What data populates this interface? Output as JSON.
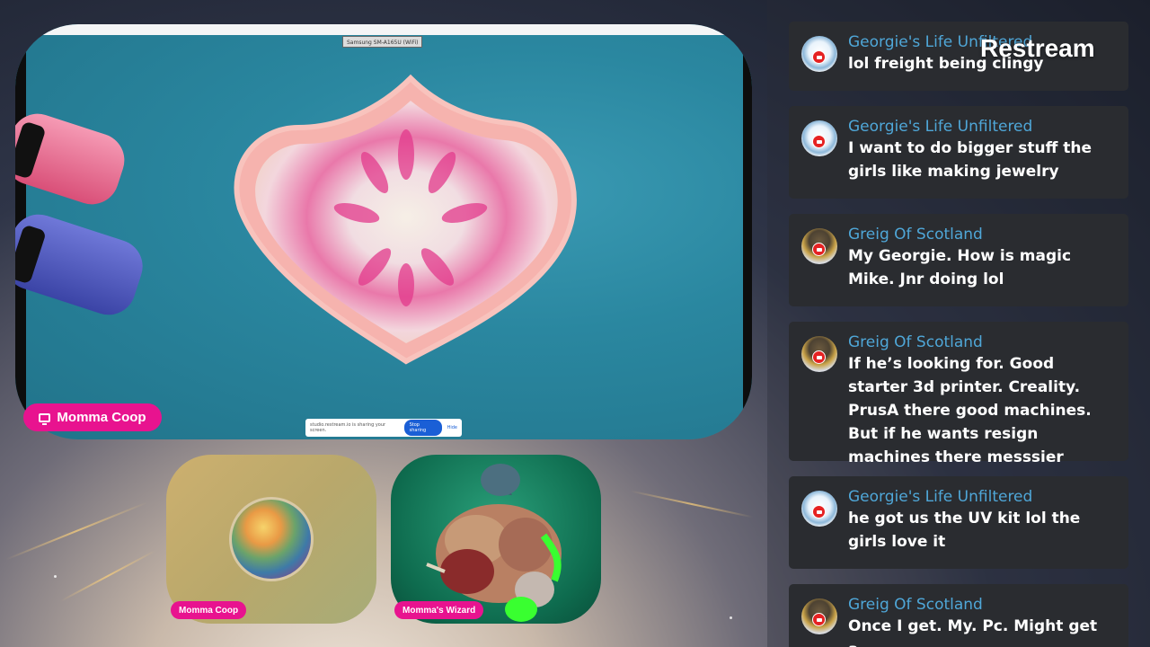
{
  "brand": "Restream",
  "screen": {
    "device_tag": "Samsung SM-A165U (WiFi)",
    "share_notice": "studio.restream.io is sharing your screen.",
    "stop_label": "Stop sharing",
    "hide_label": "Hide"
  },
  "main_source_label": "Momma Coop",
  "cameras": [
    {
      "label": "Momma Coop"
    },
    {
      "label": "Momma's Wizard"
    }
  ],
  "chat": [
    {
      "author": "Georgie's Life Unfiltered",
      "text": "lol freight being clingy",
      "avatar": "georgie-avatar",
      "platform": "youtube"
    },
    {
      "author": "Georgie's Life Unfiltered",
      "text": "I want to do bigger stuff the girls like making jewelry",
      "avatar": "georgie-avatar",
      "platform": "youtube"
    },
    {
      "author": "Greig Of Scotland",
      "text": "My Georgie. How is magic Mike. Jnr doing lol",
      "avatar": "greig-avatar",
      "platform": "youtube"
    },
    {
      "author": "Greig Of Scotland",
      "text": "If he’s looking for. Good starter 3d printer. Creality. PrusA there good machines. But if he wants resign machines there messsier",
      "avatar": "greig-avatar",
      "platform": "youtube"
    },
    {
      "author": "Georgie's Life Unfiltered",
      "text": "he got us the UV kit lol the girls love it",
      "avatar": "georgie-avatar",
      "platform": "youtube"
    },
    {
      "author": "Greig Of Scotland",
      "text": "Once I get. My. Pc. Might get a.",
      "avatar": "greig-avatar",
      "platform": "youtube"
    }
  ],
  "colors": {
    "accent_pink": "#e8138f",
    "author_blue": "#4fa7d8",
    "youtube_red": "#e52222"
  }
}
